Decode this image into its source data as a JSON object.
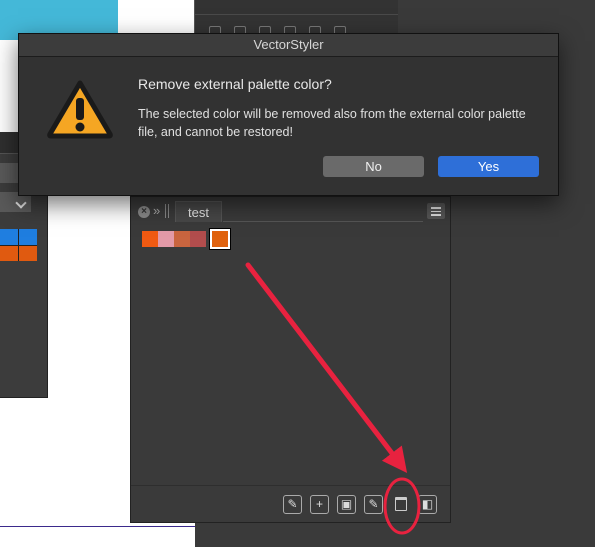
{
  "dialog": {
    "title": "VectorStyler",
    "heading": "Remove external palette color?",
    "message": "The selected color will be removed also from the external color palette file, and cannot be restored!",
    "buttons": {
      "no": "No",
      "yes": "Yes"
    },
    "icon": "warning-icon"
  },
  "swatch_panel": {
    "tab_label": "test",
    "swatches": [
      "#f05a12",
      "#e39aa8",
      "#c9653f",
      "#b24d4d"
    ],
    "selected_swatch": "#e0620e",
    "footer_icons": [
      "edit-swatch-icon",
      "add-swatch-icon",
      "add-group-icon",
      "edit-icon",
      "trash-icon",
      "palette-icon"
    ]
  },
  "colors": {
    "accent_blue": "#2e6fd8",
    "annotation_red": "#e8223f",
    "warning_yellow": "#f5a623"
  }
}
